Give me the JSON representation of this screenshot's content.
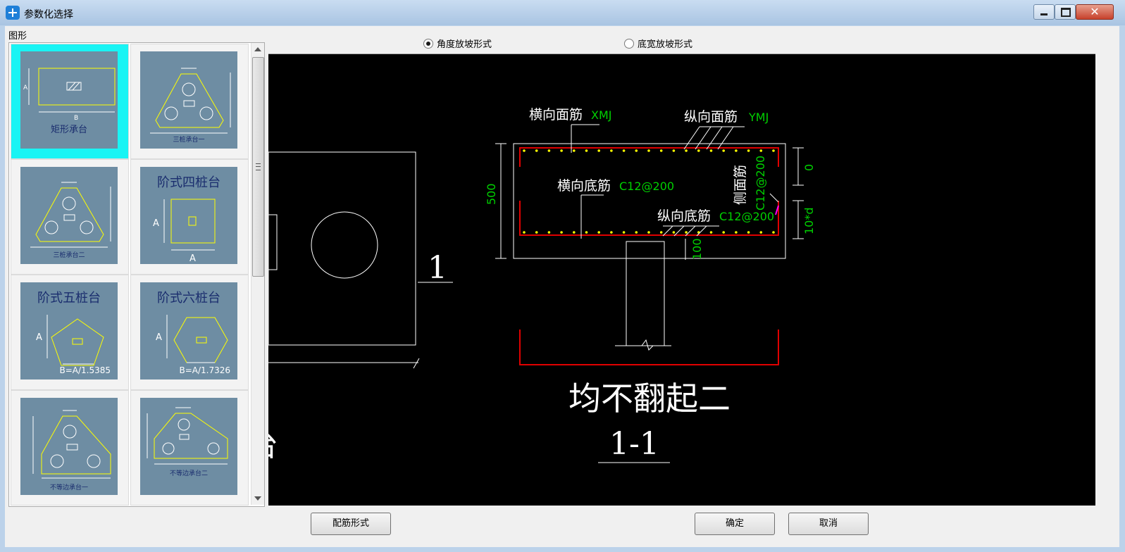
{
  "window": {
    "title": "参数化选择"
  },
  "gallery": {
    "group_label": "图形",
    "tiles": [
      {
        "caption": "矩形承台",
        "selected": true
      },
      {
        "caption": "三桩承台一"
      },
      {
        "caption": "三桩承台二"
      },
      {
        "caption": "阶式四桩台"
      },
      {
        "caption": "阶式五桩台",
        "formula": "B=A/1.5385"
      },
      {
        "caption": "阶式六桩台",
        "formula": "B=A/1.7326"
      },
      {
        "caption": "不等边承台一"
      },
      {
        "caption": "不等边承台二"
      }
    ]
  },
  "slope_mode": {
    "options": [
      {
        "label": "角度放坡形式",
        "selected": true
      },
      {
        "label": "底宽放坡形式",
        "selected": false
      }
    ]
  },
  "drawing": {
    "top_long_bar_label": "横向面筋",
    "top_long_bar_value": "XMJ",
    "top_trans_bar_label": "纵向面筋",
    "top_trans_bar_value": "YMJ",
    "bottom_long_bar_label": "横向底筋",
    "bottom_long_bar_value": "C12@200",
    "bottom_trans_bar_label": "纵向底筋",
    "bottom_trans_bar_value": "C12@200",
    "side_bar_label": "侧面筋",
    "side_bar_value": "C12@200",
    "dim_height": "500",
    "dim_top": "0",
    "dim_side": "10*d",
    "dim_bottom": "100",
    "section_mark": "1",
    "partial_text": "台",
    "caption": "均不翻起二",
    "section_label": "1-1"
  },
  "buttons": {
    "rebar_form": "配筋形式",
    "ok": "确定",
    "cancel": "取消"
  },
  "colors": {
    "thumb_bg": "#6e8da3",
    "selection": "#19f4f4",
    "rebar_red": "#e00000",
    "dim_green": "#00d000",
    "bar_yellow": "#ffff00"
  }
}
